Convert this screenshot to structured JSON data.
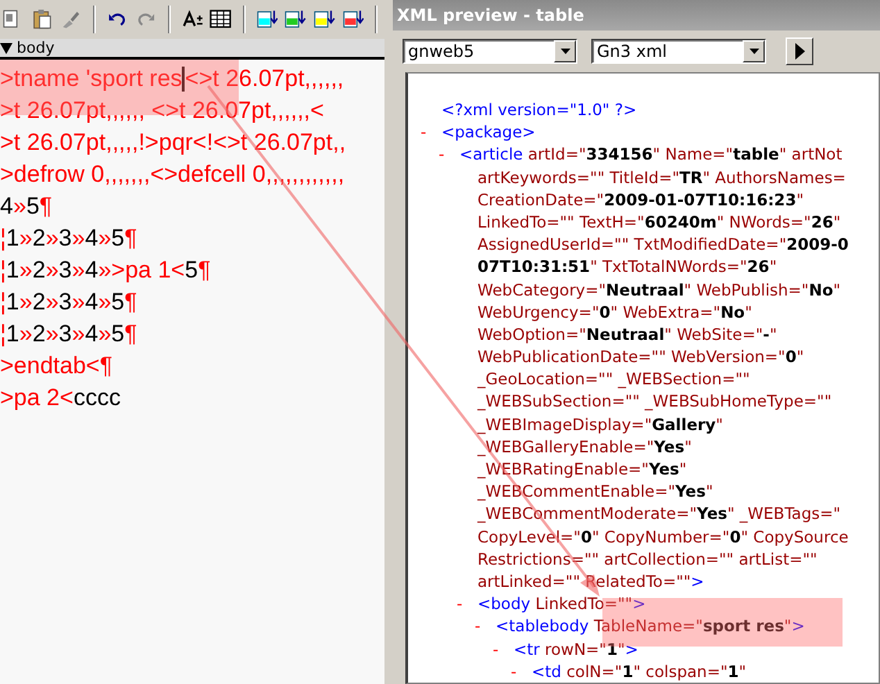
{
  "editor": {
    "section": {
      "label": "body",
      "expanded": true
    },
    "lines": [
      [
        {
          "kind": "code",
          "text": ">tname 'sport res"
        },
        {
          "kind": "caret"
        },
        {
          "kind": "code",
          "text": "<>t 26.07pt,,,,,,"
        }
      ],
      [
        {
          "kind": "code",
          "text": ">t 26.07pt,,,,,, <>t 26.07pt,,,,,,<"
        }
      ],
      [
        {
          "kind": "code",
          "text": ">t 26.07pt,,,,,!>pqr<!<>t 26.07pt,,"
        }
      ],
      [
        {
          "kind": "code",
          "text": ">defrow 0,,,,,,,<>defcell 0,,,,,,,,,,,,"
        }
      ],
      [
        {
          "kind": "text",
          "text": "4"
        },
        {
          "kind": "code",
          "text": "»"
        },
        {
          "kind": "text",
          "text": "5"
        },
        {
          "kind": "code",
          "text": "¶"
        }
      ],
      [
        {
          "kind": "code",
          "text": "¦"
        },
        {
          "kind": "text",
          "text": "1"
        },
        {
          "kind": "code",
          "text": "»"
        },
        {
          "kind": "text",
          "text": "2"
        },
        {
          "kind": "code",
          "text": "»"
        },
        {
          "kind": "text",
          "text": "3"
        },
        {
          "kind": "code",
          "text": "»"
        },
        {
          "kind": "text",
          "text": "4"
        },
        {
          "kind": "code",
          "text": "»"
        },
        {
          "kind": "text",
          "text": "5"
        },
        {
          "kind": "code",
          "text": "¶"
        }
      ],
      [
        {
          "kind": "code",
          "text": "¦"
        },
        {
          "kind": "text",
          "text": "1"
        },
        {
          "kind": "code",
          "text": "»"
        },
        {
          "kind": "text",
          "text": "2"
        },
        {
          "kind": "code",
          "text": "»"
        },
        {
          "kind": "text",
          "text": "3"
        },
        {
          "kind": "code",
          "text": "»"
        },
        {
          "kind": "text",
          "text": "4"
        },
        {
          "kind": "code",
          "text": "»>pa 1<"
        },
        {
          "kind": "text",
          "text": "5"
        },
        {
          "kind": "code",
          "text": "¶"
        }
      ],
      [
        {
          "kind": "code",
          "text": "¦"
        },
        {
          "kind": "text",
          "text": "1"
        },
        {
          "kind": "code",
          "text": "»"
        },
        {
          "kind": "text",
          "text": "2"
        },
        {
          "kind": "code",
          "text": "»"
        },
        {
          "kind": "text",
          "text": "3"
        },
        {
          "kind": "code",
          "text": "»"
        },
        {
          "kind": "text",
          "text": "4"
        },
        {
          "kind": "code",
          "text": "»"
        },
        {
          "kind": "text",
          "text": "5"
        },
        {
          "kind": "code",
          "text": "¶"
        }
      ],
      [
        {
          "kind": "code",
          "text": "¦"
        },
        {
          "kind": "text",
          "text": "1"
        },
        {
          "kind": "code",
          "text": "»"
        },
        {
          "kind": "text",
          "text": "2"
        },
        {
          "kind": "code",
          "text": "»"
        },
        {
          "kind": "text",
          "text": "3"
        },
        {
          "kind": "code",
          "text": "»"
        },
        {
          "kind": "text",
          "text": "4"
        },
        {
          "kind": "code",
          "text": "»"
        },
        {
          "kind": "text",
          "text": "5"
        },
        {
          "kind": "code",
          "text": "¶"
        }
      ],
      [
        {
          "kind": "code",
          "text": ">endtab<¶"
        }
      ],
      [
        {
          "kind": "code",
          "text": ">pa 2<"
        },
        {
          "kind": "text",
          "text": "cccc"
        }
      ]
    ]
  },
  "xml_preview": {
    "window": {
      "title": "XML preview - table"
    },
    "dropdowns": [
      {
        "value": "gnweb5"
      },
      {
        "value": "Gn3 xml"
      }
    ],
    "tree": [
      {
        "kind": "pi",
        "lines": [
          [
            {
              "kind": "markup",
              "text": "<?xml version=\"1.0\" ?>"
            }
          ]
        ]
      },
      {
        "kind": "element",
        "toggle": "-",
        "lines": [
          [
            {
              "kind": "markup",
              "text": "<package>"
            }
          ]
        ],
        "children": [
          {
            "kind": "element",
            "toggle": "-",
            "lines": [
              [
                {
                  "kind": "markup",
                  "text": "<article "
                },
                {
                  "kind": "attr",
                  "text": "artId=\""
                },
                {
                  "kind": "value",
                  "text": "334156"
                },
                {
                  "kind": "attr",
                  "text": "\" Name=\""
                },
                {
                  "kind": "value",
                  "text": "table"
                },
                {
                  "kind": "attr",
                  "text": "\" artNot"
                }
              ],
              [
                {
                  "kind": "attr",
                  "text": "artKeywords=\"\" TitleId=\""
                },
                {
                  "kind": "value",
                  "text": "TR"
                },
                {
                  "kind": "attr",
                  "text": "\" AuthorsNames="
                }
              ],
              [
                {
                  "kind": "attr",
                  "text": "CreationDate=\""
                },
                {
                  "kind": "value",
                  "text": "2009-01-07T10:16:23"
                },
                {
                  "kind": "attr",
                  "text": "\""
                }
              ],
              [
                {
                  "kind": "attr",
                  "text": "LinkedTo=\"\" TextH=\""
                },
                {
                  "kind": "value",
                  "text": "60240m"
                },
                {
                  "kind": "attr",
                  "text": "\" NWords=\""
                },
                {
                  "kind": "value",
                  "text": "26"
                },
                {
                  "kind": "attr",
                  "text": "\""
                }
              ],
              [
                {
                  "kind": "attr",
                  "text": "AssignedUserId=\"\" TxtModifiedDate=\""
                },
                {
                  "kind": "value",
                  "text": "2009-0"
                }
              ],
              [
                {
                  "kind": "value",
                  "text": "07T10:31:51"
                },
                {
                  "kind": "attr",
                  "text": "\" TxtTotalNWords=\""
                },
                {
                  "kind": "value",
                  "text": "26"
                },
                {
                  "kind": "attr",
                  "text": "\""
                }
              ],
              [
                {
                  "kind": "attr",
                  "text": "WebCategory=\""
                },
                {
                  "kind": "value",
                  "text": "Neutraal"
                },
                {
                  "kind": "attr",
                  "text": "\" WebPublish=\""
                },
                {
                  "kind": "value",
                  "text": "No"
                },
                {
                  "kind": "attr",
                  "text": "\""
                }
              ],
              [
                {
                  "kind": "attr",
                  "text": "WebUrgency=\""
                },
                {
                  "kind": "value",
                  "text": "0"
                },
                {
                  "kind": "attr",
                  "text": "\" WebExtra=\""
                },
                {
                  "kind": "value",
                  "text": "No"
                },
                {
                  "kind": "attr",
                  "text": "\""
                }
              ],
              [
                {
                  "kind": "attr",
                  "text": "WebOption=\""
                },
                {
                  "kind": "value",
                  "text": "Neutraal"
                },
                {
                  "kind": "attr",
                  "text": "\" WebSite=\""
                },
                {
                  "kind": "value",
                  "text": "-"
                },
                {
                  "kind": "attr",
                  "text": "\""
                }
              ],
              [
                {
                  "kind": "attr",
                  "text": "WebPublicationDate=\"\" WebVersion=\""
                },
                {
                  "kind": "value",
                  "text": "0"
                },
                {
                  "kind": "attr",
                  "text": "\""
                }
              ],
              [
                {
                  "kind": "attr",
                  "text": "_GeoLocation=\"\" _WEBSection=\"\""
                }
              ],
              [
                {
                  "kind": "attr",
                  "text": "_WEBSubSection=\"\" _WEBSubHomeType=\"\""
                }
              ],
              [
                {
                  "kind": "attr",
                  "text": "_WEBImageDisplay=\""
                },
                {
                  "kind": "value",
                  "text": "Gallery"
                },
                {
                  "kind": "attr",
                  "text": "\""
                }
              ],
              [
                {
                  "kind": "attr",
                  "text": "_WEBGalleryEnable=\""
                },
                {
                  "kind": "value",
                  "text": "Yes"
                },
                {
                  "kind": "attr",
                  "text": "\""
                }
              ],
              [
                {
                  "kind": "attr",
                  "text": "_WEBRatingEnable=\""
                },
                {
                  "kind": "value",
                  "text": "Yes"
                },
                {
                  "kind": "attr",
                  "text": "\""
                }
              ],
              [
                {
                  "kind": "attr",
                  "text": "_WEBCommentEnable=\""
                },
                {
                  "kind": "value",
                  "text": "Yes"
                },
                {
                  "kind": "attr",
                  "text": "\""
                }
              ],
              [
                {
                  "kind": "attr",
                  "text": "_WEBCommentModerate=\""
                },
                {
                  "kind": "value",
                  "text": "Yes"
                },
                {
                  "kind": "attr",
                  "text": "\" _WEBTags=\""
                }
              ],
              [
                {
                  "kind": "attr",
                  "text": "CopyLevel=\""
                },
                {
                  "kind": "value",
                  "text": "0"
                },
                {
                  "kind": "attr",
                  "text": "\" CopyNumber=\""
                },
                {
                  "kind": "value",
                  "text": "0"
                },
                {
                  "kind": "attr",
                  "text": "\" CopySource"
                }
              ],
              [
                {
                  "kind": "attr",
                  "text": "Restrictions=\"\" artCollection=\"\" artList=\"\""
                }
              ],
              [
                {
                  "kind": "attr",
                  "text": "artLinked=\"\" RelatedTo=\"\""
                },
                {
                  "kind": "markup",
                  "text": ">"
                }
              ]
            ],
            "children": [
              {
                "kind": "element",
                "toggle": "-",
                "lines": [
                  [
                    {
                      "kind": "markup",
                      "text": "<body "
                    },
                    {
                      "kind": "attr",
                      "text": "LinkedTo=\"\""
                    },
                    {
                      "kind": "markup",
                      "text": ">"
                    }
                  ]
                ],
                "children": [
                  {
                    "kind": "element",
                    "toggle": "-",
                    "lines": [
                      [
                        {
                          "kind": "markup",
                          "text": "<tablebody "
                        },
                        {
                          "kind": "attr",
                          "text": "TableName=\""
                        },
                        {
                          "kind": "value",
                          "text": "sport res"
                        },
                        {
                          "kind": "attr",
                          "text": "\""
                        },
                        {
                          "kind": "markup",
                          "text": ">"
                        }
                      ]
                    ],
                    "children": [
                      {
                        "kind": "element",
                        "toggle": "-",
                        "lines": [
                          [
                            {
                              "kind": "markup",
                              "text": "<tr "
                            },
                            {
                              "kind": "attr",
                              "text": "rowN=\""
                            },
                            {
                              "kind": "value",
                              "text": "1"
                            },
                            {
                              "kind": "attr",
                              "text": "\""
                            },
                            {
                              "kind": "markup",
                              "text": ">"
                            }
                          ]
                        ],
                        "children": [
                          {
                            "kind": "element",
                            "toggle": "-",
                            "lines": [
                              [
                                {
                                  "kind": "markup",
                                  "text": "<td "
                                },
                                {
                                  "kind": "attr",
                                  "text": "colN=\""
                                },
                                {
                                  "kind": "value",
                                  "text": "1"
                                },
                                {
                                  "kind": "attr",
                                  "text": "\" colspan=\""
                                },
                                {
                                  "kind": "value",
                                  "text": "1"
                                },
                                {
                                  "kind": "attr",
                                  "text": "\""
                                }
                              ]
                            ]
                          }
                        ]
                      }
                    ]
                  }
                ]
              }
            ]
          }
        ]
      }
    ]
  }
}
